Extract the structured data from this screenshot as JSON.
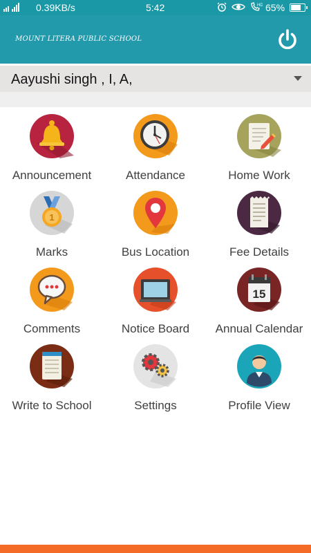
{
  "status_bar": {
    "network_speed": "0.39KB/s",
    "time": "5:42",
    "battery_percent": "65%",
    "battery_level": 0.65,
    "icons": [
      "signal-icon",
      "alarm-icon",
      "eye-icon",
      "hd-call-icon",
      "battery-icon"
    ]
  },
  "app_bar": {
    "school_name": "MOUNT LITERA PUBLIC SCHOOL",
    "power_icon": "power-icon"
  },
  "student_selector": {
    "selected": "Aayushi singh , I, A,"
  },
  "menu": [
    {
      "label": "Announcement",
      "icon": "bell-icon",
      "color": "#b8233f"
    },
    {
      "label": "Attendance",
      "icon": "clock-icon",
      "color": "#f39a1c"
    },
    {
      "label": "Home Work",
      "icon": "notebook-pencil-icon",
      "color": "#a6a45c"
    },
    {
      "label": "Marks",
      "icon": "medal-icon",
      "color": "#d6d6d6"
    },
    {
      "label": "Bus Location",
      "icon": "map-pin-icon",
      "color": "#f39a1c"
    },
    {
      "label": "Fee Details",
      "icon": "receipt-icon",
      "color": "#4c2942"
    },
    {
      "label": "Comments",
      "icon": "speech-bubble-icon",
      "color": "#f39a1c"
    },
    {
      "label": "Notice Board",
      "icon": "board-icon",
      "color": "#e6502b"
    },
    {
      "label": "Annual Calendar",
      "icon": "calendar-icon",
      "color": "#7a2525"
    },
    {
      "label": "Write to School",
      "icon": "notepad-icon",
      "color": "#7a2d14"
    },
    {
      "label": "Settings",
      "icon": "gears-icon",
      "color": "#e4e4e4"
    },
    {
      "label": "Profile View",
      "icon": "user-profile-icon",
      "color": "#1ba5b8"
    }
  ],
  "calendar_day": "15",
  "colors": {
    "status_bar": "#1b98a6",
    "app_bar": "#239aab",
    "selector_bg": "#e6e3e3",
    "bottom_accent": "#f46a27"
  }
}
